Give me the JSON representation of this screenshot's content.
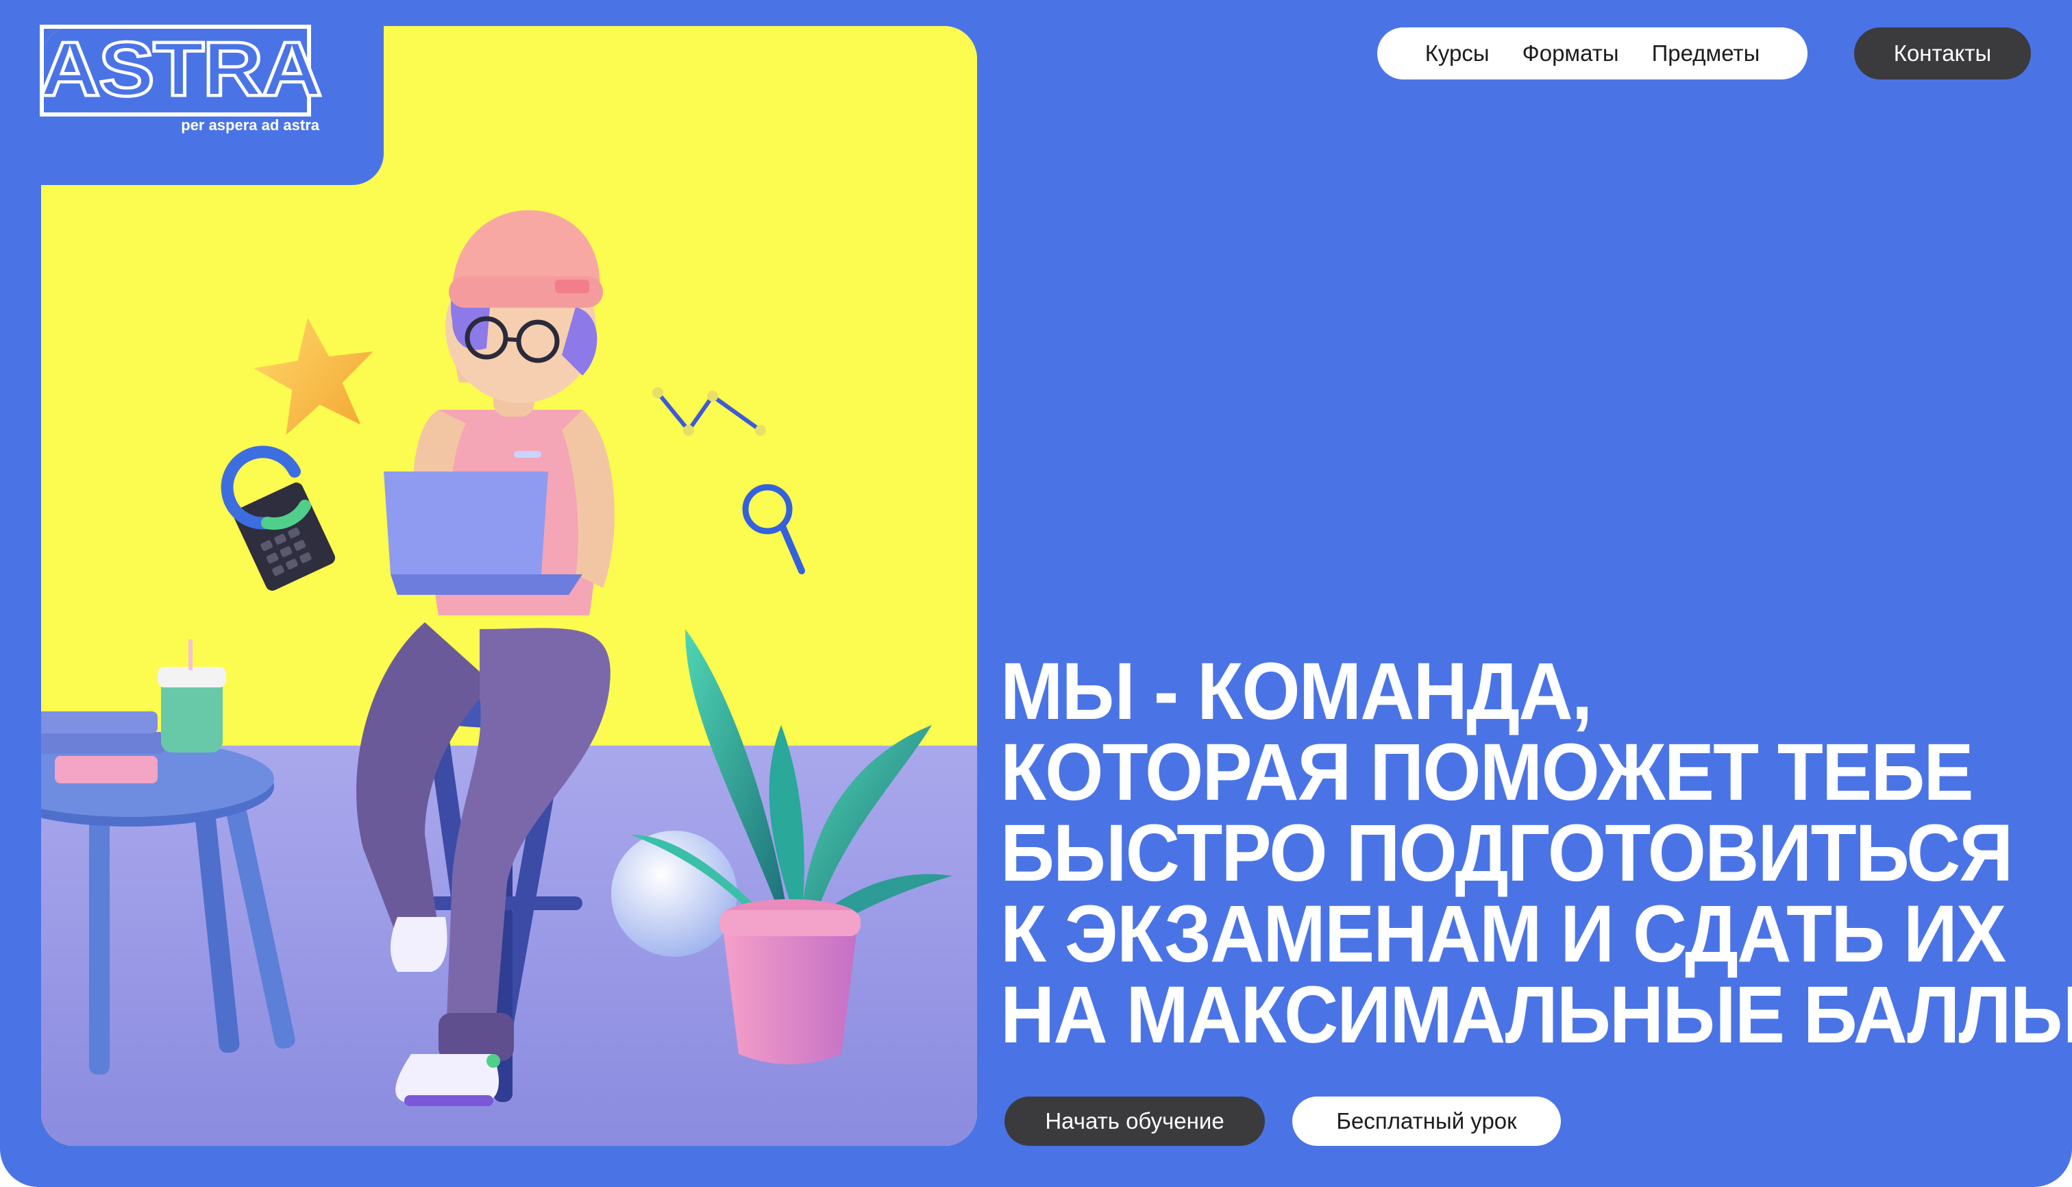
{
  "logo": {
    "wordmark": "ASTRA",
    "tagline": "per aspera ad astra"
  },
  "nav": {
    "links": [
      "Курсы",
      "Форматы",
      "Предметы"
    ],
    "contacts_label": "Контакты"
  },
  "hero": {
    "headline_lines": [
      "МЫ - КОМАНДА,",
      "КОТОРАЯ ПОМОЖЕТ ТЕБЕ",
      "БЫСТРО ПОДГОТОВИТЬСЯ",
      "К ЭКЗАМЕНАМ И СДАТЬ ИХ",
      "НА МАКСИМАЛЬНЫЕ БАЛЛЫ."
    ],
    "primary_cta": "Начать обучение",
    "secondary_cta": "Бесплатный урок"
  },
  "colors": {
    "page_background": "#4a74e6",
    "illustration_wall": "#fcfb4f",
    "illustration_floor": "#9d9de6",
    "dark_button": "#3b3b3e",
    "light_button": "#ffffff"
  },
  "icons": [
    "star-icon",
    "calculator-icon",
    "chart-icon",
    "magnifier-icon"
  ]
}
